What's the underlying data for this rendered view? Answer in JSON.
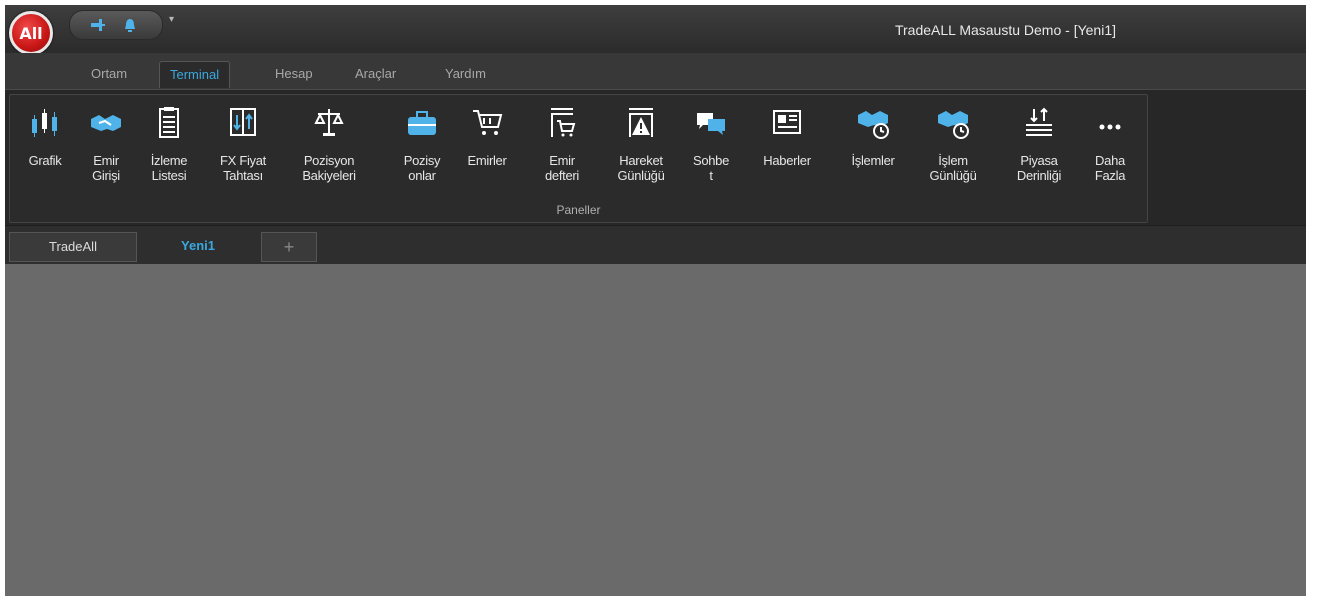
{
  "window": {
    "logo_text": "All",
    "title": "TradeALL Masaustu Demo - [Yeni1]"
  },
  "quick_access": {
    "items": [
      "pin-icon",
      "bell-icon"
    ],
    "dropdown_glyph": "▾"
  },
  "ribbon_tabs": [
    {
      "label": "Ortam",
      "active": false
    },
    {
      "label": "Terminal",
      "active": true
    },
    {
      "label": "Hesap",
      "active": false
    },
    {
      "label": "Araçlar",
      "active": false
    },
    {
      "label": "Yardım",
      "active": false
    }
  ],
  "ribbon": {
    "group_label": "Paneller",
    "buttons": [
      {
        "label": "Grafik",
        "icon": "candlestick-chart-icon"
      },
      {
        "label": "Emir\nGirişi",
        "icon": "handshake-icon"
      },
      {
        "label": "İzleme\nListesi",
        "icon": "clipboard-list-icon"
      },
      {
        "label": "FX Fiyat\nTahtası",
        "icon": "price-board-icon"
      },
      {
        "label": "Pozisyon\nBakiyeleri",
        "icon": "balance-scale-icon"
      },
      {
        "label": "Pozisy\nonlar",
        "icon": "briefcase-icon"
      },
      {
        "label": "Emirler",
        "icon": "cart-icon"
      },
      {
        "label": "Emir\ndefteri",
        "icon": "order-book-icon"
      },
      {
        "label": "Hareket\nGünlüğü",
        "icon": "warning-log-icon"
      },
      {
        "label": "Sohbe\nt",
        "icon": "chat-icon"
      },
      {
        "label": "Haberler",
        "icon": "newspaper-icon"
      },
      {
        "label": "İşlemler",
        "icon": "handshake-clock-icon"
      },
      {
        "label": "İşlem\nGünlüğü",
        "icon": "handshake-clock-icon"
      },
      {
        "label": "Piyasa\nDerinliği",
        "icon": "market-depth-icon"
      },
      {
        "label": "Daha\nFazla",
        "icon": "more-icon"
      }
    ]
  },
  "document_tabs": [
    {
      "label": "TradeAll",
      "active": false
    },
    {
      "label": "Yeni1",
      "active": true
    },
    {
      "label": "+",
      "active": false
    }
  ],
  "colors": {
    "accent": "#3aa8e0",
    "workspace": "#6a6a6a",
    "ribbon_bg": "#2b2b2b"
  }
}
